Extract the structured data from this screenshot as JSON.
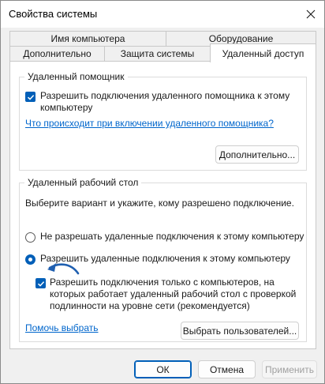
{
  "window": {
    "title": "Свойства системы"
  },
  "tabs": {
    "row1": [
      "Имя компьютера",
      "Оборудование"
    ],
    "row2": [
      "Дополнительно",
      "Защита системы",
      "Удаленный доступ"
    ]
  },
  "assistance": {
    "legend": "Удаленный помощник",
    "checkbox_label": "Разрешить подключения удаленного помощника к этому компьютеру",
    "checkbox_checked": true,
    "link": "Что происходит при включении удаленного помощника?",
    "advanced_button": "Дополнительно..."
  },
  "desktop": {
    "legend": "Удаленный рабочий стол",
    "prompt": "Выберите вариант и укажите, кому разрешено подключение.",
    "options": [
      {
        "label": "Не разрешать удаленные подключения к этому компьютеру",
        "selected": false
      },
      {
        "label": "Разрешить удаленные подключения к этому компьютеру",
        "selected": true
      }
    ],
    "nla_label": "Разрешить подключения только с компьютеров, на которых работает удаленный рабочий стол с проверкой подлинности на уровне сети (рекомендуется)",
    "nla_checked": true,
    "help_link": "Помочь выбрать",
    "select_users_button": "Выбрать пользователей..."
  },
  "footer": {
    "ok": "ОК",
    "cancel": "Отмена",
    "apply": "Применить"
  },
  "colors": {
    "accent": "#005fb8",
    "link": "#0066cc"
  }
}
